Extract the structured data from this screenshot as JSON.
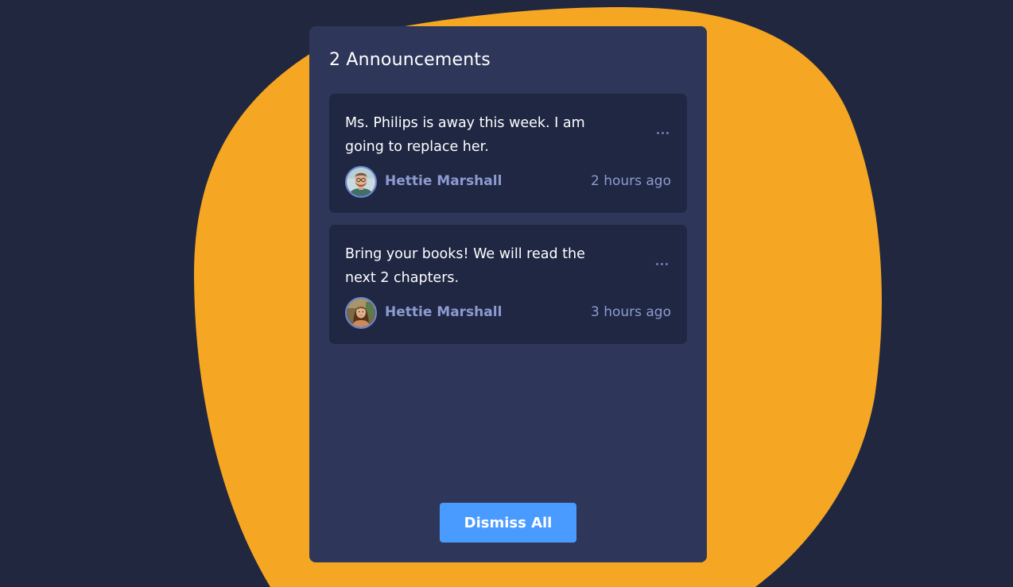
{
  "colors": {
    "page_background": "#20273f",
    "blob": "#f5a623",
    "panel": "#2e375a",
    "card": "#1f2743",
    "accent_text": "#8e9bd0",
    "button": "#4a9bff"
  },
  "panel": {
    "title": "2 Announcements"
  },
  "announcements": [
    {
      "text": "Ms. Philips is away this week. I am going to replace her.",
      "author": "Hettie Marshall",
      "time": "2 hours ago",
      "avatar": "man-with-beard-and-glasses-avatar",
      "menu_icon": "more-horizontal-icon"
    },
    {
      "text": "Bring your books! We will read the next 2 chapters.",
      "author": "Hettie Marshall",
      "time": "3 hours ago",
      "avatar": "woman-with-long-hair-avatar",
      "menu_icon": "more-horizontal-icon"
    }
  ],
  "footer": {
    "dismiss_label": "Dismiss All"
  }
}
